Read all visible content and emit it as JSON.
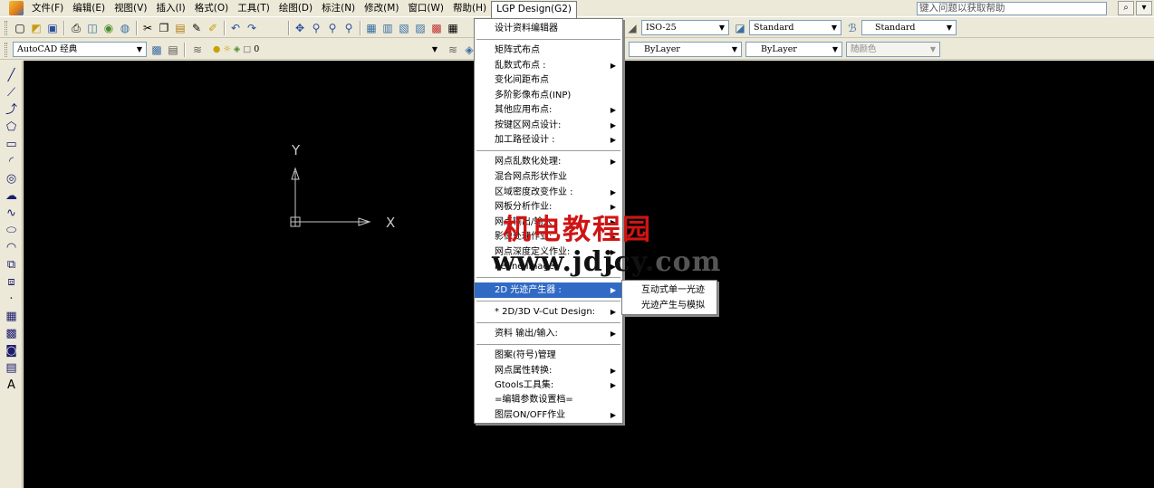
{
  "menubar": {
    "items": [
      "文件(F)",
      "编辑(E)",
      "视图(V)",
      "插入(I)",
      "格式(O)",
      "工具(T)",
      "绘图(D)",
      "标注(N)",
      "修改(M)",
      "窗口(W)",
      "帮助(H)",
      "LGP Design(G2)"
    ],
    "help_placeholder": "键入问题以获取帮助"
  },
  "toolbar1": {
    "dimstyle": "ISO-25",
    "textstyle": "Standard",
    "tablestyle": "Standard"
  },
  "toolbar2": {
    "workspace": "AutoCAD 经典",
    "layer": "0",
    "linetype": "ByLayer",
    "lineweight": "ByLayer",
    "plotstyle": "随颜色"
  },
  "canvas": {
    "ucs_y": "Y",
    "ucs_x": "X"
  },
  "dropdown": {
    "items": [
      {
        "label": "设计资料编辑器",
        "submenu": false
      },
      {
        "label": "矩阵式布点",
        "submenu": false
      },
      {
        "label": "乱数式布点 :",
        "submenu": true
      },
      {
        "label": "变化间距布点",
        "submenu": false
      },
      {
        "label": "多阶影像布点(INP)",
        "submenu": false
      },
      {
        "label": "其他应用布点:",
        "submenu": true
      },
      {
        "label": "按键区网点设计:",
        "submenu": true
      },
      {
        "label": "加工路径设计 :",
        "submenu": true
      },
      {
        "label": "网点乱数化处理:",
        "submenu": true
      },
      {
        "label": "混合网点形状作业",
        "submenu": false
      },
      {
        "label": "区域密度改变作业 :",
        "submenu": true
      },
      {
        "label": "网板分析作业:",
        "submenu": true
      },
      {
        "label": "网点输出/输入",
        "submenu": true
      },
      {
        "label": "影像处理作业:",
        "submenu": true
      },
      {
        "label": "网点深度定义作业:",
        "submenu": true
      },
      {
        "label": "Refine Image :",
        "submenu": true
      },
      {
        "label": "2D 光迹产生器 :",
        "submenu": true
      },
      {
        "label": "* 2D/3D V-Cut Design:",
        "submenu": true
      },
      {
        "label": "资料 输出/输入:",
        "submenu": true
      },
      {
        "label": "图案(符号)管理",
        "submenu": false
      },
      {
        "label": "网点属性转换:",
        "submenu": true
      },
      {
        "label": "Gtools工具集:",
        "submenu": true
      },
      {
        "label": "=编辑参数设置档=",
        "submenu": false
      },
      {
        "label": "图层ON/OFF作业",
        "submenu": true
      }
    ]
  },
  "submenu": {
    "items": [
      "互动式单一光迹",
      "光迹产生与模拟"
    ]
  },
  "watermark": {
    "line1": "机电教程园",
    "line2": "www.jdjcy.",
    "line2_tail": "com"
  },
  "colors": {
    "highlight": "#316ac5",
    "canvas": "#000000",
    "watermark_red": "#d01414"
  }
}
